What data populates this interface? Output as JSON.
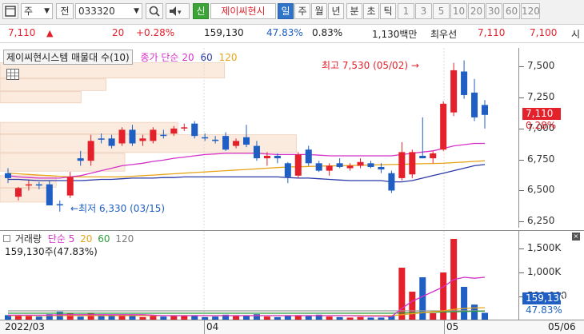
{
  "toolbar": {
    "square_icon": "square-icon",
    "period_select": "주",
    "prev_label": "전",
    "code_value": "033320",
    "search_icon": "magnifier-icon",
    "sound_icon": "speaker-icon",
    "new_badge": "신",
    "stock_name": "제이씨현시",
    "periods": [
      "일",
      "주",
      "월",
      "년",
      "분",
      "초",
      "틱"
    ],
    "active_period": "일",
    "intervals": [
      "1",
      "3",
      "5",
      "10",
      "20",
      "30",
      "60",
      "120"
    ]
  },
  "info": {
    "price": "7,110",
    "change_arrow": "▲",
    "change": "20",
    "change_pct": "+0.28%",
    "volume": "159,130",
    "vol_ratio": "47.83%",
    "turnover": "0.83%",
    "amount": "1,130백만",
    "best_bid_label": "최우선",
    "ask": "7,110",
    "bid": "7,100",
    "tail": "시"
  },
  "price_legend": {
    "title": "제이씨현시스템 매물대 수(10)",
    "ma_prefix": "종가 단순",
    "ma_periods": [
      "20",
      "60",
      "120"
    ],
    "ma_colors": [
      "#d431c8",
      "#2b3aa8",
      "#e8a418"
    ]
  },
  "annotations": {
    "high": "최고 7,530 (05/02)",
    "low": "최저 6,330 (03/15)"
  },
  "price_axis": {
    "ticks": [
      "7,500",
      "7,250",
      "7,000",
      "6,750",
      "6,500",
      "6,250"
    ],
    "current_tag": "7,110",
    "current_pct": "0.28%"
  },
  "volume_legend": {
    "name": "거래량",
    "ma_prefix": "단순",
    "ma_periods": [
      "5",
      "20",
      "60",
      "120"
    ],
    "ma_colors": [
      "#d431c8",
      "#e8a418",
      "#2e9e3a",
      "#7a7a7a"
    ],
    "value_line": "159,130주(47.83%)"
  },
  "volume_axis": {
    "ticks": [
      "1,500K",
      "1,000K",
      "500,000"
    ],
    "current_tag": "159,130",
    "current_pct": "47.83%"
  },
  "date_axis": {
    "labels": [
      "2022/03",
      "04",
      "05",
      "05/06"
    ]
  },
  "chart_data": {
    "type": "candlestick",
    "price_range": [
      6200,
      7650
    ],
    "volume_range": [
      0,
      1800000
    ],
    "candles": [
      {
        "o": 6640,
        "h": 6680,
        "l": 6560,
        "c": 6600,
        "v": 110000
      },
      {
        "o": 6450,
        "h": 6530,
        "l": 6420,
        "c": 6520,
        "v": 100000
      },
      {
        "o": 6540,
        "h": 6580,
        "l": 6500,
        "c": 6550,
        "v": 90000
      },
      {
        "o": 6550,
        "h": 6570,
        "l": 6510,
        "c": 6540,
        "v": 80000
      },
      {
        "o": 6550,
        "h": 6580,
        "l": 6420,
        "c": 6380,
        "v": 130000
      },
      {
        "o": 6390,
        "h": 6420,
        "l": 6330,
        "c": 6380,
        "v": 180000
      },
      {
        "o": 6460,
        "h": 6650,
        "l": 6440,
        "c": 6610,
        "v": 150000
      },
      {
        "o": 6760,
        "h": 6820,
        "l": 6700,
        "c": 6740,
        "v": 80000
      },
      {
        "o": 6740,
        "h": 6950,
        "l": 6700,
        "c": 6900,
        "v": 160000
      },
      {
        "o": 6920,
        "h": 6960,
        "l": 6880,
        "c": 6910,
        "v": 90000
      },
      {
        "o": 6920,
        "h": 6950,
        "l": 6840,
        "c": 6860,
        "v": 100000
      },
      {
        "o": 6880,
        "h": 7010,
        "l": 6860,
        "c": 6990,
        "v": 120000
      },
      {
        "o": 6990,
        "h": 7030,
        "l": 6860,
        "c": 6880,
        "v": 110000
      },
      {
        "o": 6900,
        "h": 6950,
        "l": 6860,
        "c": 6920,
        "v": 70000
      },
      {
        "o": 6900,
        "h": 7010,
        "l": 6880,
        "c": 6990,
        "v": 100000
      },
      {
        "o": 6950,
        "h": 6990,
        "l": 6920,
        "c": 6940,
        "v": 80000
      },
      {
        "o": 6960,
        "h": 7020,
        "l": 6940,
        "c": 7000,
        "v": 90000
      },
      {
        "o": 7000,
        "h": 7040,
        "l": 6980,
        "c": 7010,
        "v": 100000
      },
      {
        "o": 7040,
        "h": 7060,
        "l": 6920,
        "c": 6940,
        "v": 110000
      },
      {
        "o": 6930,
        "h": 6960,
        "l": 6900,
        "c": 6920,
        "v": 70000
      },
      {
        "o": 6910,
        "h": 6940,
        "l": 6880,
        "c": 6900,
        "v": 80000
      },
      {
        "o": 6940,
        "h": 6970,
        "l": 6820,
        "c": 6830,
        "v": 120000
      },
      {
        "o": 6860,
        "h": 6920,
        "l": 6840,
        "c": 6900,
        "v": 90000
      },
      {
        "o": 6930,
        "h": 7030,
        "l": 6850,
        "c": 6870,
        "v": 100000
      },
      {
        "o": 6860,
        "h": 6900,
        "l": 6740,
        "c": 6760,
        "v": 130000
      },
      {
        "o": 6760,
        "h": 6810,
        "l": 6700,
        "c": 6780,
        "v": 80000
      },
      {
        "o": 6780,
        "h": 6800,
        "l": 6720,
        "c": 6760,
        "v": 70000
      },
      {
        "o": 6720,
        "h": 6730,
        "l": 6560,
        "c": 6610,
        "v": 100000
      },
      {
        "o": 6620,
        "h": 6810,
        "l": 6600,
        "c": 6790,
        "v": 110000
      },
      {
        "o": 6830,
        "h": 6860,
        "l": 6700,
        "c": 6720,
        "v": 90000
      },
      {
        "o": 6720,
        "h": 6740,
        "l": 6650,
        "c": 6660,
        "v": 120000
      },
      {
        "o": 6660,
        "h": 6720,
        "l": 6620,
        "c": 6700,
        "v": 80000
      },
      {
        "o": 6720,
        "h": 6760,
        "l": 6680,
        "c": 6690,
        "v": 70000
      },
      {
        "o": 6680,
        "h": 6720,
        "l": 6660,
        "c": 6700,
        "v": 60000
      },
      {
        "o": 6700,
        "h": 6760,
        "l": 6680,
        "c": 6730,
        "v": 70000
      },
      {
        "o": 6720,
        "h": 6740,
        "l": 6680,
        "c": 6690,
        "v": 60000
      },
      {
        "o": 6690,
        "h": 6720,
        "l": 6640,
        "c": 6670,
        "v": 60000
      },
      {
        "o": 6640,
        "h": 6660,
        "l": 6480,
        "c": 6500,
        "v": 100000
      },
      {
        "o": 6600,
        "h": 6890,
        "l": 6580,
        "c": 6810,
        "v": 1100000
      },
      {
        "o": 6630,
        "h": 6830,
        "l": 6600,
        "c": 6810,
        "v": 600000
      },
      {
        "o": 6780,
        "h": 7090,
        "l": 6760,
        "c": 6760,
        "v": 900000
      },
      {
        "o": 6760,
        "h": 6820,
        "l": 6720,
        "c": 6800,
        "v": 150000
      },
      {
        "o": 6830,
        "h": 7220,
        "l": 6820,
        "c": 7200,
        "v": 1000000
      },
      {
        "o": 7130,
        "h": 7530,
        "l": 7100,
        "c": 7470,
        "v": 1700000
      },
      {
        "o": 7460,
        "h": 7550,
        "l": 7240,
        "c": 7270,
        "v": 700000
      },
      {
        "o": 7290,
        "h": 7400,
        "l": 7060,
        "c": 7090,
        "v": 330000
      },
      {
        "o": 7190,
        "h": 7230,
        "l": 7000,
        "c": 7110,
        "v": 159130
      }
    ],
    "ma20_price": [
      6620,
      6610,
      6605,
      6600,
      6600,
      6600,
      6610,
      6620,
      6640,
      6660,
      6680,
      6700,
      6710,
      6720,
      6735,
      6745,
      6760,
      6770,
      6780,
      6790,
      6795,
      6800,
      6800,
      6800,
      6800,
      6795,
      6790,
      6790,
      6790,
      6790,
      6785,
      6780,
      6780,
      6780,
      6780,
      6780,
      6780,
      6780,
      6790,
      6800,
      6810,
      6820,
      6840,
      6860,
      6870,
      6880,
      6880
    ],
    "ma60_price": [
      6590,
      6590,
      6585,
      6580,
      6580,
      6580,
      6580,
      6580,
      6585,
      6590,
      6590,
      6595,
      6600,
      6600,
      6600,
      6605,
      6605,
      6610,
      6610,
      6610,
      6610,
      6610,
      6610,
      6610,
      6610,
      6610,
      6610,
      6605,
      6600,
      6600,
      6595,
      6590,
      6585,
      6580,
      6580,
      6580,
      6580,
      6570,
      6570,
      6580,
      6600,
      6620,
      6640,
      6660,
      6680,
      6700,
      6710
    ],
    "ma120_price": [
      6640,
      6635,
      6630,
      6625,
      6620,
      6615,
      6610,
      6610,
      6610,
      6610,
      6610,
      6610,
      6615,
      6620,
      6625,
      6630,
      6635,
      6640,
      6645,
      6650,
      6655,
      6660,
      6665,
      6670,
      6675,
      6680,
      6685,
      6690,
      6692,
      6694,
      6696,
      6698,
      6700,
      6702,
      6704,
      6706,
      6708,
      6710,
      6712,
      6714,
      6716,
      6718,
      6720,
      6725,
      6730,
      6735,
      6740
    ],
    "vol_ma5": [
      110000,
      110000,
      110000,
      110000,
      110000,
      120000,
      120000,
      120000,
      120000,
      120000,
      120000,
      120000,
      120000,
      120000,
      110000,
      100000,
      100000,
      100000,
      100000,
      100000,
      100000,
      100000,
      100000,
      100000,
      100000,
      100000,
      100000,
      100000,
      100000,
      100000,
      100000,
      100000,
      100000,
      100000,
      90000,
      90000,
      90000,
      80000,
      250000,
      400000,
      500000,
      600000,
      700000,
      850000,
      900000,
      880000,
      900000
    ],
    "vol_ma20": [
      100000,
      100000,
      100000,
      100000,
      100000,
      100000,
      100000,
      100000,
      100000,
      100000,
      100000,
      100000,
      100000,
      100000,
      100000,
      100000,
      100000,
      100000,
      100000,
      100000,
      100000,
      100000,
      100000,
      100000,
      100000,
      100000,
      100000,
      100000,
      100000,
      100000,
      100000,
      100000,
      100000,
      100000,
      100000,
      100000,
      100000,
      100000,
      120000,
      140000,
      160000,
      180000,
      200000,
      230000,
      250000,
      260000,
      265000
    ],
    "vol_ma60": [
      150000,
      150000,
      150000,
      150000,
      150000,
      150000,
      150000,
      150000,
      150000,
      150000,
      150000,
      150000,
      150000,
      150000,
      150000,
      150000,
      150000,
      150000,
      150000,
      150000,
      150000,
      150000,
      150000,
      150000,
      150000,
      150000,
      150000,
      150000,
      150000,
      150000,
      150000,
      150000,
      150000,
      150000,
      150000,
      150000,
      150000,
      150000,
      155000,
      160000,
      165000,
      170000,
      175000,
      180000,
      185000,
      190000,
      195000
    ],
    "vol_ma120": [
      200000,
      200000,
      200000,
      200000,
      200000,
      200000,
      200000,
      200000,
      200000,
      200000,
      200000,
      200000,
      200000,
      200000,
      200000,
      200000,
      200000,
      200000,
      200000,
      200000,
      200000,
      200000,
      200000,
      200000,
      200000,
      200000,
      200000,
      200000,
      200000,
      200000,
      200000,
      200000,
      200000,
      200000,
      200000,
      200000,
      200000,
      200000,
      200000,
      200000,
      200000,
      200000,
      200000,
      200000,
      200000,
      200000,
      200000
    ],
    "volume_profile": [
      {
        "from": 7400,
        "to": 7530,
        "weight": 0.72
      },
      {
        "from": 7300,
        "to": 7400,
        "weight": 0.34
      },
      {
        "from": 7200,
        "to": 7300,
        "weight": 0.26
      },
      {
        "from": 6950,
        "to": 7050,
        "weight": 0.57
      },
      {
        "from": 6800,
        "to": 6950,
        "weight": 0.95
      },
      {
        "from": 6650,
        "to": 6800,
        "weight": 0.4
      },
      {
        "from": 6520,
        "to": 6620,
        "weight": 0.18
      },
      {
        "from": 6400,
        "to": 6520,
        "weight": 0.16
      }
    ],
    "colors": {
      "up": "#e4212b",
      "down": "#1f5fc4"
    }
  }
}
